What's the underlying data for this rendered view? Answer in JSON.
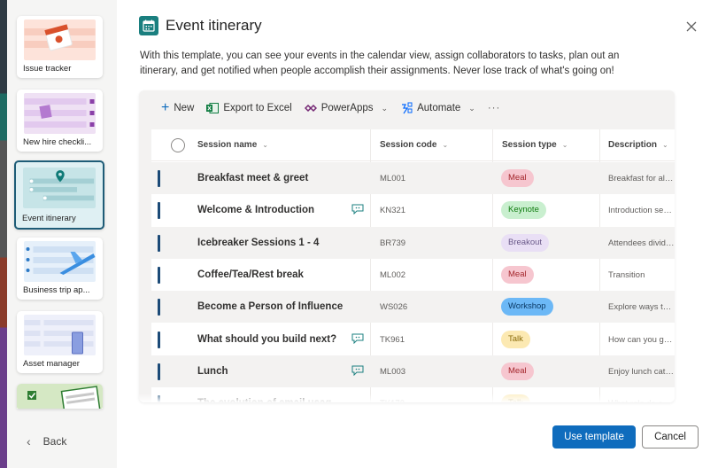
{
  "sidebar": {
    "templates": [
      {
        "label": "Issue tracker",
        "selected": false,
        "icon": "calendar-alert-icon",
        "color": "#fbe0d8"
      },
      {
        "label": "New hire checkli...",
        "selected": false,
        "icon": "clipboard-icon",
        "color": "#ecdcf2"
      },
      {
        "label": "Event itinerary",
        "selected": true,
        "icon": "location-pin-icon",
        "color": "#cfe7ea"
      },
      {
        "label": "Business trip ap...",
        "selected": false,
        "icon": "airplane-icon",
        "color": "#e3eef9"
      },
      {
        "label": "Asset manager",
        "selected": false,
        "icon": "device-icon",
        "color": "#e6e9f6"
      },
      {
        "label": "",
        "selected": false,
        "icon": "checklist-icon",
        "color": "#dceccb"
      }
    ],
    "back_label": "Back"
  },
  "dialog": {
    "title": "Event itinerary",
    "description": "With this template, you can see your events in the calendar view, assign collaborators to tasks, plan out an itinerary, and get notified when people accomplish their assignments. Never lose track of what's going on!",
    "accent": "#1a7f7f",
    "toolbar": {
      "new_label": "New",
      "export_label": "Export to Excel",
      "powerapps_label": "PowerApps",
      "automate_label": "Automate",
      "more_label": "···"
    },
    "columns": {
      "name": "Session name",
      "code": "Session code",
      "type": "Session type",
      "description": "Description"
    },
    "rows": [
      {
        "name": "Breakfast meet & greet",
        "comment": false,
        "code": "ML001",
        "type": "Meal",
        "description": "Breakfast for all atten..."
      },
      {
        "name": "Welcome & Introduction",
        "comment": true,
        "code": "KN321",
        "type": "Keynote",
        "description": "Introduction session ..."
      },
      {
        "name": "Icebreaker Sessions 1 - 4",
        "comment": false,
        "code": "BR739",
        "type": "Breakout",
        "description": "Attendees divide into..."
      },
      {
        "name": "Coffee/Tea/Rest break",
        "comment": false,
        "code": "ML002",
        "type": "Meal",
        "description": "Transition"
      },
      {
        "name": "Become a Person of Influence",
        "comment": false,
        "code": "WS026",
        "type": "Workshop",
        "description": "Explore ways to influe..."
      },
      {
        "name": "What should you build next?",
        "comment": true,
        "code": "TK961",
        "type": "Talk",
        "description": "How can you get over..."
      },
      {
        "name": "Lunch",
        "comment": true,
        "code": "ML003",
        "type": "Meal",
        "description": "Enjoy lunch catered b..."
      },
      {
        "name": "The evolution of email usag...",
        "comment": false,
        "code": "TK173",
        "type": "Talk",
        "description": "What role do email..."
      }
    ],
    "type_colors": {
      "Meal": {
        "bg": "#f6c6cf",
        "fg": "#a4262c"
      },
      "Keynote": {
        "bg": "#c9efcf",
        "fg": "#107c10"
      },
      "Breakout": {
        "bg": "#e9dff5",
        "fg": "#6b5a8a"
      },
      "Workshop": {
        "bg": "#6cb8f6",
        "fg": "#0b3a66"
      },
      "Talk": {
        "bg": "#fce9b2",
        "fg": "#8a6b0a"
      }
    },
    "use_template_label": "Use template",
    "cancel_label": "Cancel",
    "primary_color": "#0f6cbd"
  }
}
